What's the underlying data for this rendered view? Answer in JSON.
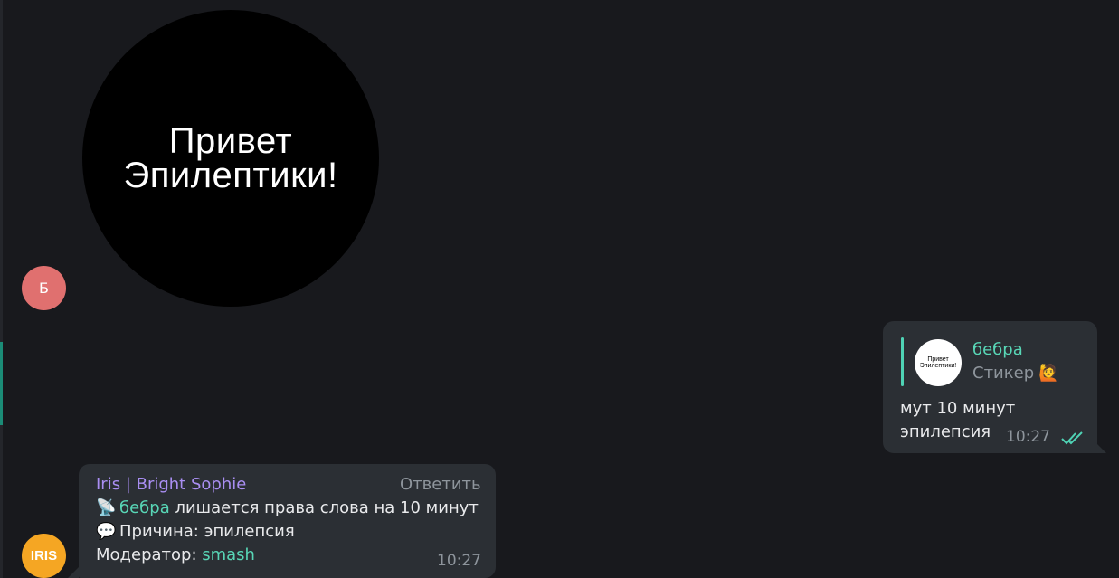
{
  "sticker": {
    "line1": "Привет",
    "line2": "Эпилептики!"
  },
  "avatars": {
    "sender1_initial": "Б",
    "bot_label": "IRIS"
  },
  "outgoing": {
    "reply": {
      "thumb_line1": "Привет",
      "thumb_line2": "Эпилептики!",
      "name": "бебра",
      "type": "Стикер",
      "emoji": "🙋"
    },
    "text_line1": "мут 10 минут",
    "text_line2": "эпилепсия",
    "time": "10:27",
    "status": "read"
  },
  "incoming": {
    "sender": "Iris | Bright Sophie",
    "reply_label": "Ответить",
    "line1_emoji": "📡",
    "line1_mention": "бебра",
    "line1_text": " лишается права слова на 10 минут",
    "line2_emoji": "💬",
    "line2_text": "Причина: эпилепсия",
    "line3_label": "Модератор: ",
    "line3_mention": "smash",
    "time": "10:27"
  },
  "colors": {
    "background": "#18191d",
    "bubble": "#2b2f34",
    "accent": "#58d6b6",
    "sender_name": "#a98ef2"
  }
}
